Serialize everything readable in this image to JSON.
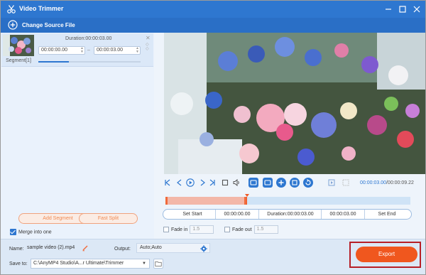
{
  "window": {
    "title": "Video Trimmer",
    "accent": "#2e77d0",
    "export_color": "#f0571e",
    "highlight_color": "#b71f27"
  },
  "source": {
    "label": "Change Source File"
  },
  "segment": {
    "label": "Segment[1]",
    "duration": "Duration:00:00:03.00",
    "start": "00:00:00.00",
    "end": "00:00:03.00",
    "progress": 0.3
  },
  "left_actions": {
    "add_segment": "Add Segment",
    "fast_split": "Fast Split",
    "merge_label": "Merge into one",
    "merge_checked": true
  },
  "playback": {
    "current": "00:00:03.00",
    "total": "/00:00:09.22",
    "selection_fraction": 0.33
  },
  "set_row": {
    "set_start": "Set Start",
    "start_value": "00:00:00.00",
    "duration": "Duration:00:00:03.00",
    "end_value": "00:00:03.00",
    "set_end": "Set End"
  },
  "fade": {
    "fade_in_label": "Fade in",
    "fade_in_value": "1.5",
    "fade_out_label": "Fade out",
    "fade_out_value": "1.5"
  },
  "bottom": {
    "name_label": "Name:",
    "name_value": "sample video (2).mp4",
    "output_label": "Output:",
    "output_value": "Auto;Auto",
    "save_label": "Save to:",
    "save_path": "C:\\AnyMP4 Studio\\A...r Ultimate\\Trimmer",
    "export_label": "Export"
  }
}
